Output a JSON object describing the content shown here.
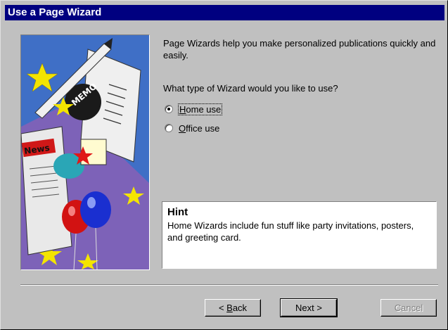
{
  "window": {
    "title": "Use a Page Wizard"
  },
  "illustration": {
    "memo_text": "MEMO",
    "news_text": "News"
  },
  "content": {
    "intro": "Page Wizards help you make personalized publications quickly and easily.",
    "question": "What type of Wizard would you like to use?",
    "options": [
      {
        "label": "Home use",
        "selected": true
      },
      {
        "label": "Office use",
        "selected": false
      }
    ]
  },
  "hint": {
    "title": "Hint",
    "text": "Home Wizards include fun stuff like party invitations, posters, and greeting card."
  },
  "buttons": {
    "back": "< Back",
    "next": "Next >",
    "cancel": "Cancel"
  },
  "colors": {
    "titlebar": "#000080",
    "face": "#c0c0c0"
  }
}
